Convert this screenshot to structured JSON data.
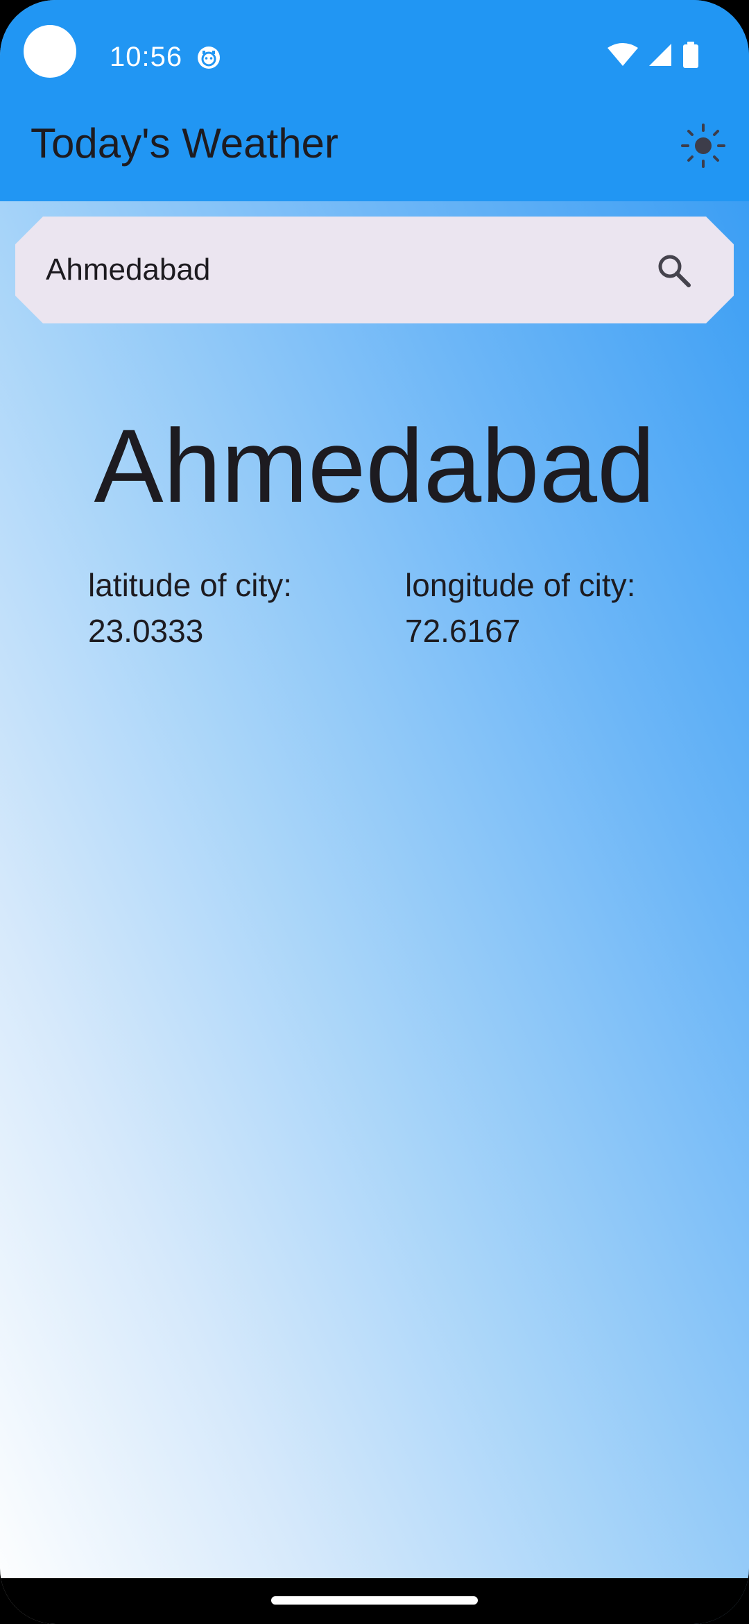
{
  "status_bar": {
    "time": "10:56",
    "icons": [
      "camera-cutout",
      "app-notification-icon",
      "wifi-icon",
      "signal-icon",
      "battery-icon"
    ]
  },
  "app_bar": {
    "title": "Today's Weather",
    "theme_icon": "sun-icon",
    "color": "#2196f3"
  },
  "search": {
    "value": "Ahmedabad",
    "icon": "search-icon",
    "background": "#ebe5f0"
  },
  "city": {
    "name": "Ahmedabad",
    "latitude_label": "latitude of city:",
    "latitude_value": "23.0333",
    "longitude_label": "longitude of city:",
    "longitude_value": "72.6167"
  },
  "colors": {
    "text": "#1d1b20",
    "gradient_top": "#2f98f3",
    "gradient_bottom": "#ffffff"
  }
}
